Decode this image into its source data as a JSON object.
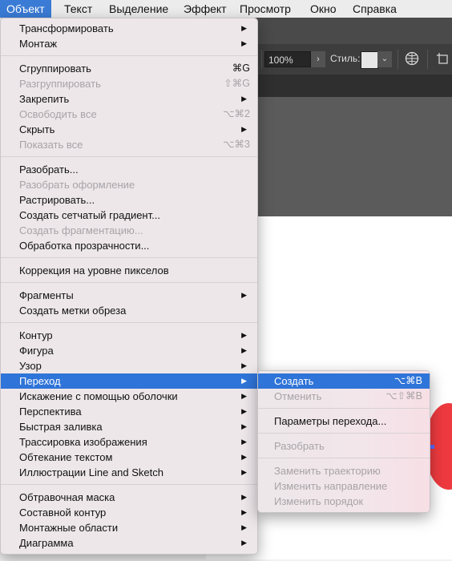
{
  "menubar": {
    "items": [
      {
        "label": "Объект",
        "active": true
      },
      {
        "label": "Текст"
      },
      {
        "label": "Выделение"
      },
      {
        "label": "Эффект"
      },
      {
        "label": "Просмотр"
      },
      {
        "label": "Окно"
      },
      {
        "label": "Справка"
      }
    ]
  },
  "toolbar": {
    "zoom_value": "100%",
    "zoom_arrow": "›",
    "style_label": "Стиль:",
    "style_dropdown": "⌄"
  },
  "object_menu": {
    "items": [
      {
        "label": "Трансформировать",
        "arrow": "▶"
      },
      {
        "label": "Монтаж",
        "arrow": "▶"
      },
      {
        "label": "Сгруппировать",
        "shortcut": "⌘G"
      },
      {
        "label": "Разгруппировать",
        "shortcut": "⇧⌘G",
        "disabled": true
      },
      {
        "label": "Закрепить",
        "arrow": "▶"
      },
      {
        "label": "Освободить все",
        "shortcut": "⌥⌘2",
        "disabled": true
      },
      {
        "label": "Скрыть",
        "arrow": "▶"
      },
      {
        "label": "Показать все",
        "shortcut": "⌥⌘3",
        "disabled": true
      },
      {
        "label": "Разобрать..."
      },
      {
        "label": "Разобрать оформление",
        "disabled": true
      },
      {
        "label": "Растрировать..."
      },
      {
        "label": "Создать сетчатый градиент..."
      },
      {
        "label": "Создать фрагментацию...",
        "disabled": true
      },
      {
        "label": "Обработка прозрачности..."
      },
      {
        "label": "Коррекция на уровне пикселов"
      },
      {
        "label": "Фрагменты",
        "arrow": "▶"
      },
      {
        "label": "Создать метки обреза"
      },
      {
        "label": "Контур",
        "arrow": "▶"
      },
      {
        "label": "Фигура",
        "arrow": "▶"
      },
      {
        "label": "Узор",
        "arrow": "▶"
      },
      {
        "label": "Переход",
        "arrow": "▶",
        "highlighted": true
      },
      {
        "label": "Искажение с помощью оболочки",
        "arrow": "▶"
      },
      {
        "label": "Перспектива",
        "arrow": "▶"
      },
      {
        "label": "Быстрая заливка",
        "arrow": "▶"
      },
      {
        "label": "Трассировка изображения",
        "arrow": "▶"
      },
      {
        "label": "Обтекание текстом",
        "arrow": "▶"
      },
      {
        "label": "Иллюстрации Line and Sketch",
        "arrow": "▶"
      },
      {
        "label": "Обтравочная маска",
        "arrow": "▶"
      },
      {
        "label": "Составной контур",
        "arrow": "▶"
      },
      {
        "label": "Монтажные области",
        "arrow": "▶"
      },
      {
        "label": "Диаграмма",
        "arrow": "▶"
      }
    ]
  },
  "blend_submenu": {
    "items": [
      {
        "label": "Создать",
        "shortcut": "⌥⌘B",
        "highlighted": true
      },
      {
        "label": "Отменить",
        "shortcut": "⌥⇧⌘B",
        "disabled": true
      },
      {
        "label": "Параметры перехода..."
      },
      {
        "label": "Разобрать",
        "disabled": true
      },
      {
        "label": "Заменить траекторию",
        "disabled": true
      },
      {
        "label": "Изменить направление",
        "disabled": true
      },
      {
        "label": "Изменить порядок",
        "disabled": true
      }
    ]
  },
  "colors": {
    "highlight": "#2f74d8",
    "menu_background": "#ede7ea",
    "disabled_text": "#a7a3a6",
    "artwork_red": "#ee3a3f"
  }
}
